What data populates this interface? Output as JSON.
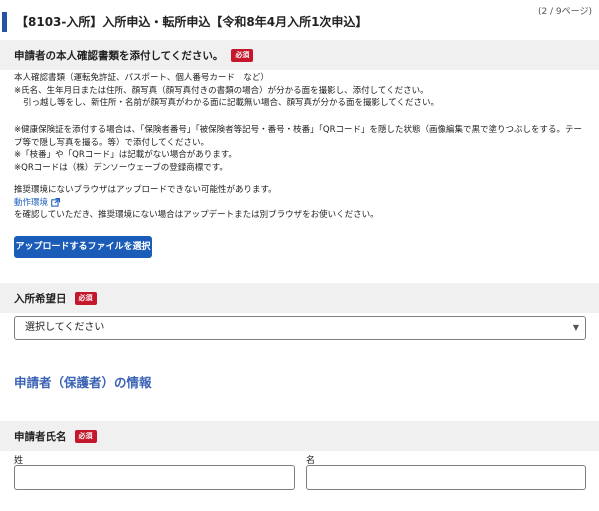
{
  "page_indicator": "(2 / 9ページ)",
  "form_title": "【8103-入所】入所申込・転所申込【令和8年4月入所1次申込】",
  "required_badge": "必須",
  "doc_section": {
    "label": "申請者の本人確認書類を添付してください。",
    "lines": [
      "本人確認書類（運転免許証、パスポート、個人番号カード　など）",
      "※氏名、生年月日または住所、顔写真（顔写真付きの書類の場合）が分かる面を撮影し、添付してください。",
      "引っ越し等をし、新住所・名前が顔写真がわかる面に記載無い場合、顔写真が分かる面を撮影してください。",
      "※健康保険証を添付する場合は、「保険者番号」「被保険者等記号・番号・枝番」「QRコード」を隠した状態（画像編集で黒で塗りつぶしをする。テー",
      "プ等で隠し写真を撮る。等）で添付してください。",
      "※「枝番」や「QRコード」は記載がない場合があります。",
      "※QRコードは（株）デンソーウェーブの登録商標です。",
      "推奨環境にないブラウザはアップロードできない可能性があります。",
      "を確認していただき、推奨環境にない場合はアップデートまたは別ブラウザをお使いください。"
    ],
    "link_label": "動作環境",
    "upload_button": "アップロードするファイルを選択"
  },
  "date_section": {
    "label": "入所希望日",
    "select_value": "選択してください"
  },
  "guardian_heading": "申請者（保護者）の情報",
  "name_section": {
    "label": "申請者氏名",
    "last_name_label": "姓",
    "first_name_label": "名",
    "last_name_value": "",
    "first_name_value": ""
  },
  "colors": {
    "accent": "#2553a3",
    "required": "#c5172b",
    "button": "#1b5cb8",
    "link": "#1f5fbf",
    "section_bg": "#f0f0f0",
    "heading": "#3b63b5"
  }
}
